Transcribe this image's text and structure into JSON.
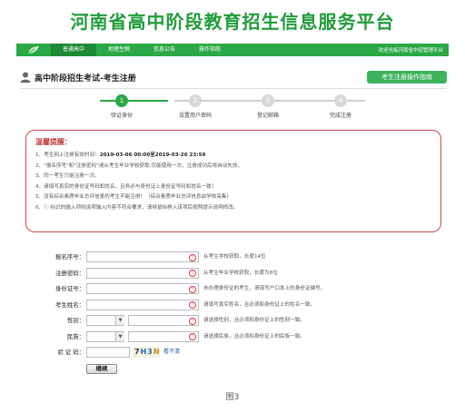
{
  "banner": {
    "title": "河南省高中阶段教育招生信息服务平台"
  },
  "nav": {
    "items": [
      {
        "label": "普通高中",
        "active": true
      },
      {
        "label": "地理生物",
        "active": false
      },
      {
        "label": "信息公告",
        "active": false
      },
      {
        "label": "操作指南",
        "active": false
      }
    ],
    "welcome": "欢迎光临河南省中招管理平台"
  },
  "page": {
    "title": "高中阶段招生考试-考生注册",
    "guide_button": "考生注册操作指南"
  },
  "steps": [
    {
      "num": "1",
      "label": "验证身份",
      "active": true
    },
    {
      "num": "2",
      "label": "设置用户密码",
      "active": false
    },
    {
      "num": "3",
      "label": "登记邮箱",
      "active": false
    },
    {
      "num": "4",
      "label": "完成注册",
      "active": false
    }
  ],
  "notice": {
    "title": "温馨提醒：",
    "line1_prefix": "1、考生网上注册有效时间：",
    "line1_time": "2019-03-06 00:00至2019-03-26 23:59",
    "line2": "2、\"报名序号\"和\"注册密码\"请从考生毕业学校获取,仅能使用一次，注册成功后将自动失效。",
    "line3": "3、同一考生只能注册一次。",
    "line4": "4、请填写真实的身份证号码和姓名，且务必与身份证上身份证号码和姓名一致！",
    "line5": "5、没有综合素质毕业总评信息的考生不能注册！（综合素质毕业总评信息由学校采集）",
    "line6": "6、ⓘ 标识的输入项则该项输入内容不符合要求，请将鼠标移入该项后按照提示说明修改。"
  },
  "form": {
    "reg_no": {
      "label": "报名序号：",
      "hint": "从考生学校获取，长度14位"
    },
    "reg_pwd": {
      "label": "注册密码：",
      "hint": "从考生毕业学校获取，长度为6位"
    },
    "id_no": {
      "label": "身份证号：",
      "hint": "未办理身份证的考生，请填写户口本上的身份证编号。"
    },
    "name": {
      "label": "考生姓名：",
      "hint": "请填写真实姓名，且必须和身份证上的姓名一致。"
    },
    "gender": {
      "label": "性别：",
      "hint": "请选择性别，且必须和身份证上的性别一致。"
    },
    "nation": {
      "label": "民族：",
      "hint": "请选择民族，且必须和身份证上的民族一致。"
    },
    "captcha": {
      "label": "验 证 码：",
      "code1": "7",
      "code2": "H3",
      "code3": "N",
      "refresh": "看不清"
    },
    "next_button": "继续"
  },
  "caption": "图3",
  "colors": {
    "brand_green": "#2aa845",
    "notice_red": "#c94a4a"
  }
}
